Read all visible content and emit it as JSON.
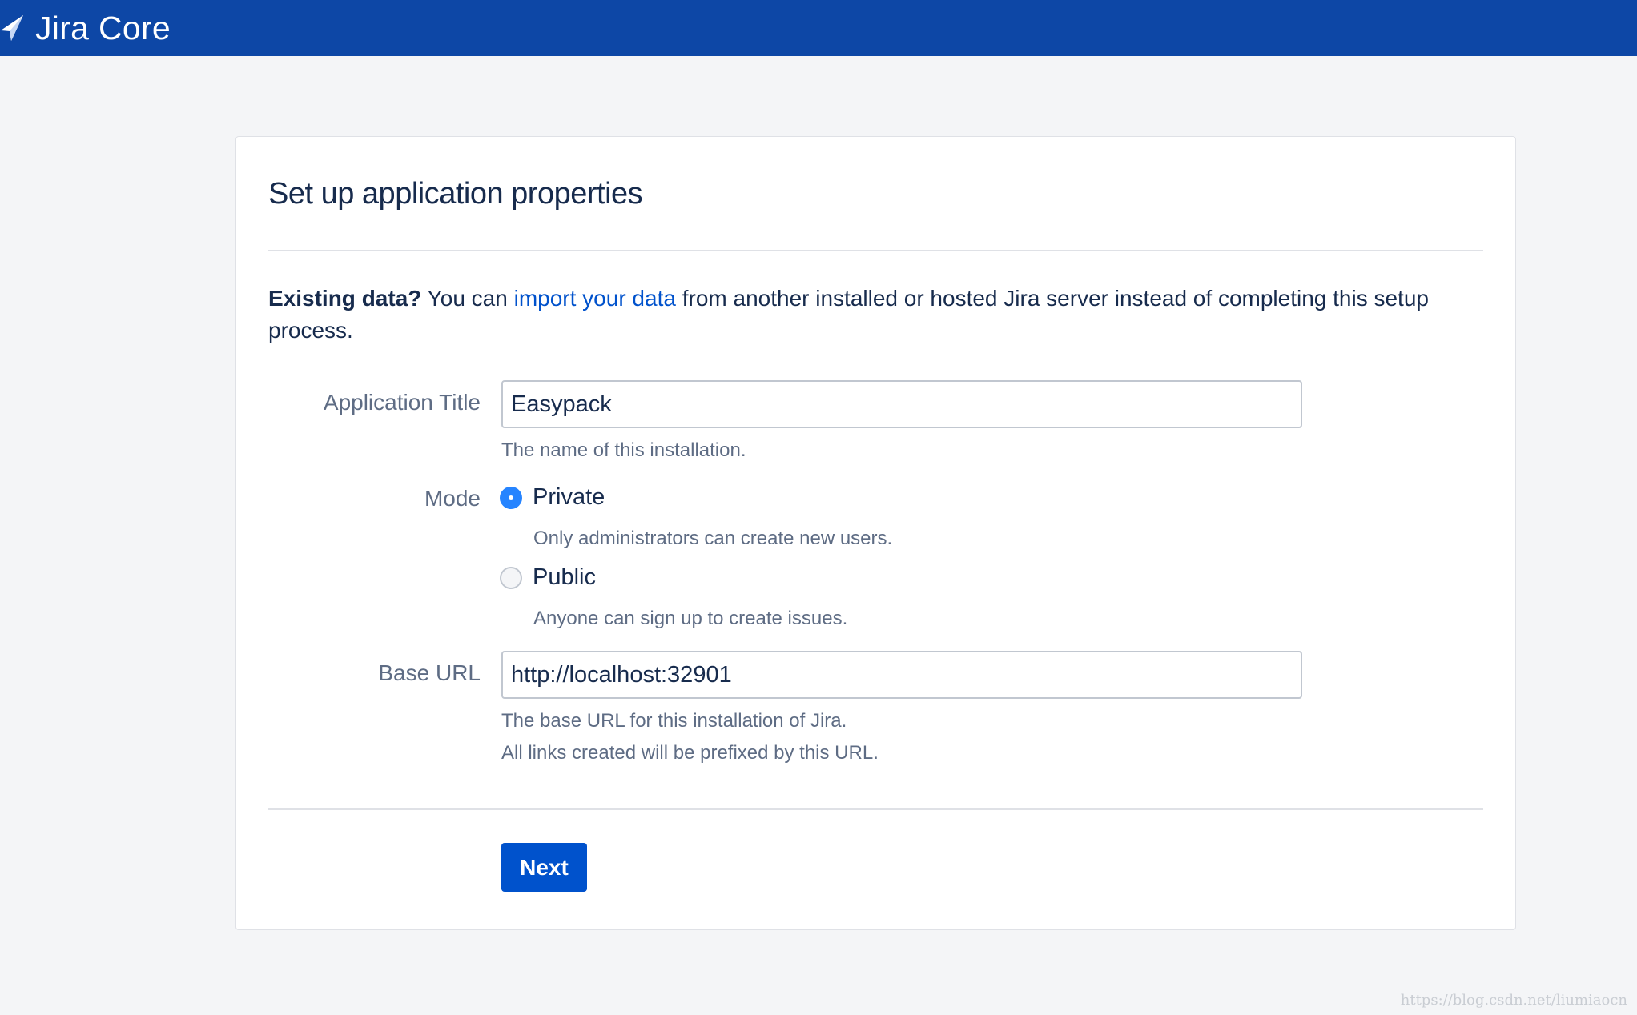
{
  "app": {
    "name": "Jira Core",
    "brand_color": "#0d47a6",
    "logo_icon": "jira-core-logo-icon"
  },
  "page": {
    "title": "Set up application properties"
  },
  "intro": {
    "bold": "Existing data?",
    "before_link": " You can ",
    "link": "import your data",
    "after_link": " from another installed or hosted Jira server instead of completing this setup process."
  },
  "form": {
    "app_title": {
      "label": "Application Title",
      "value": "Easypack",
      "help": "The name of this installation."
    },
    "mode": {
      "label": "Mode",
      "selected": "Private",
      "options": [
        {
          "label": "Private",
          "help": "Only administrators can create new users."
        },
        {
          "label": "Public",
          "help": "Anyone can sign up to create issues."
        }
      ]
    },
    "base_url": {
      "label": "Base URL",
      "value": "http://localhost:32901",
      "help_line1": "The base URL for this installation of Jira.",
      "help_line2": "All links created will be prefixed by this URL."
    },
    "next_label": "Next"
  },
  "watermark": "https://blog.csdn.net/liumiaocn",
  "colors": {
    "primary_button": "#0052cc",
    "radio_checked": "#2684ff",
    "link": "#0052cc"
  }
}
